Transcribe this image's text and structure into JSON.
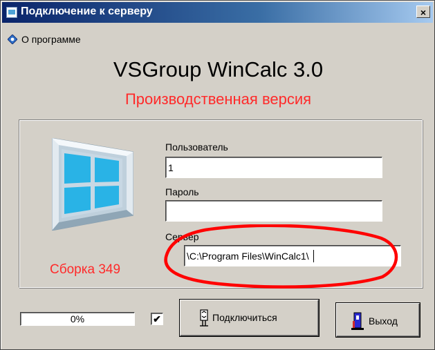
{
  "window": {
    "title": "Подключение к серверу",
    "close_label": "×"
  },
  "menu": {
    "about_label": "О программе"
  },
  "header": {
    "app_title": "VSGroup WinCalc 3.0",
    "edition": "Производственная версия"
  },
  "build_label": "Сборка 349",
  "form": {
    "user_label": "Пользователь",
    "user_value": "1",
    "password_label": "Пароль",
    "password_value": "",
    "server_label": "Сервер",
    "server_value": "\\C:\\Program Files\\WinCalc1\\"
  },
  "progress": {
    "value": 0,
    "text": "0%"
  },
  "checkbox": {
    "checked": true,
    "glyph": "✔"
  },
  "buttons": {
    "connect_label": "Подключиться",
    "exit_label": "Выход"
  },
  "colors": {
    "accent_red": "#ff2a2a",
    "title_bar": "#0a246a",
    "face": "#d4d0c8",
    "window_frame": "#29b3e6"
  },
  "icons": {
    "title": "app-window-icon",
    "about": "info-diamond-icon",
    "connect": "connect-plug-icon",
    "exit": "exit-door-icon",
    "illustration": "window-illustration-icon"
  }
}
